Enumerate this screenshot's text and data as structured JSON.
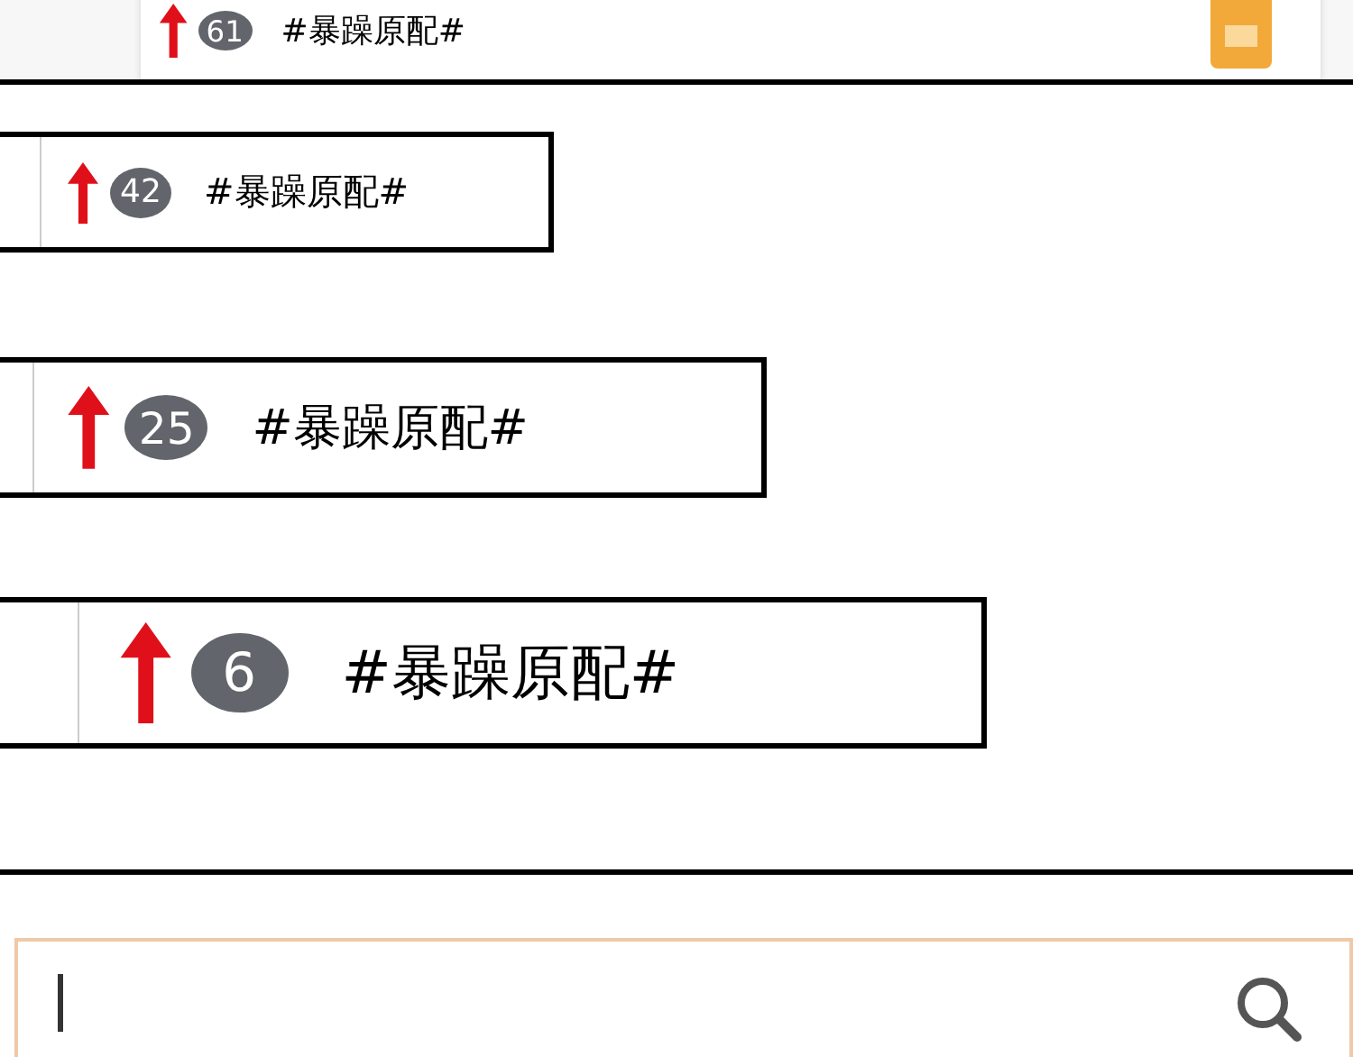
{
  "items": [
    {
      "kind": "card",
      "rising": true,
      "rank": "61",
      "topic": "#暴躁原配#"
    },
    {
      "kind": "panel",
      "rising": true,
      "rank": "42",
      "topic": "#暴躁原配#"
    },
    {
      "kind": "panel",
      "rising": true,
      "rank": "25",
      "topic": "#暴躁原配#"
    },
    {
      "kind": "panel",
      "rising": true,
      "rank": "6",
      "topic": "#暴躁原配#"
    }
  ],
  "search": {
    "focused": true
  }
}
